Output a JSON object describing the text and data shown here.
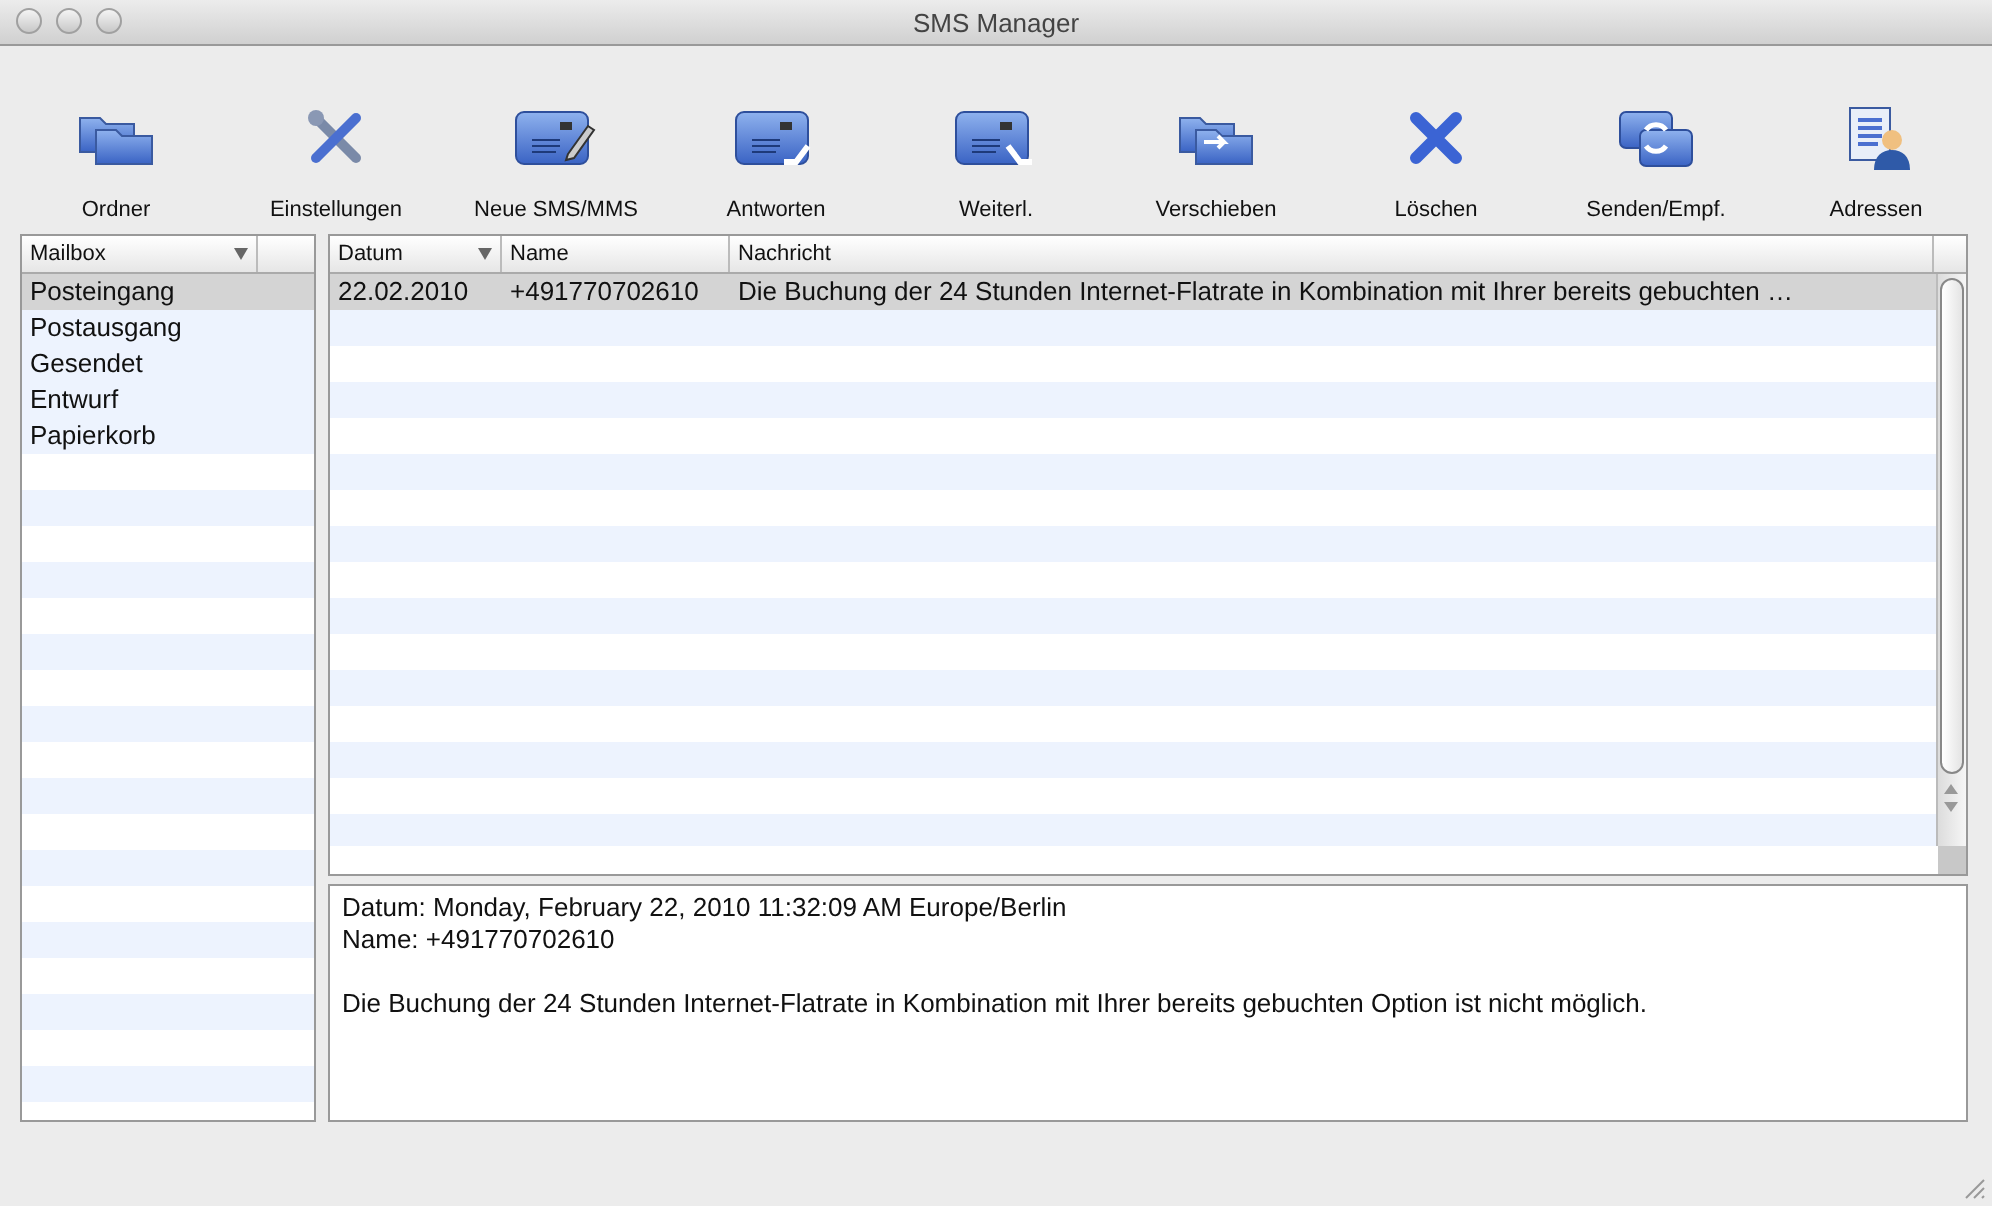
{
  "window": {
    "title": "SMS Manager"
  },
  "toolbar": [
    {
      "label": "Ordner",
      "kind": "folders"
    },
    {
      "label": "Einstellungen",
      "kind": "tools"
    },
    {
      "label": "Neue SMS/MMS",
      "kind": "compose"
    },
    {
      "label": "Antworten",
      "kind": "reply"
    },
    {
      "label": "Weiterl.",
      "kind": "forward"
    },
    {
      "label": "Verschieben",
      "kind": "move"
    },
    {
      "label": "Löschen",
      "kind": "delete"
    },
    {
      "label": "Senden/Empf.",
      "kind": "sync"
    },
    {
      "label": "Adressen",
      "kind": "contacts"
    }
  ],
  "mailboxes": {
    "column": "Mailbox",
    "items": [
      {
        "label": "Posteingang",
        "selected": true
      },
      {
        "label": "Postausgang",
        "selected": false
      },
      {
        "label": "Gesendet",
        "selected": false
      },
      {
        "label": "Entwurf",
        "selected": false
      },
      {
        "label": "Papierkorb",
        "selected": false
      }
    ]
  },
  "messages": {
    "columns": [
      "Datum",
      "Name",
      "Nachricht"
    ],
    "rows": [
      {
        "date": "22.02.2010",
        "name": "+491770702610",
        "text": "Die Buchung der 24 Stunden Internet-Flatrate in Kombination mit Ihrer bereits gebuchten …",
        "selected": true
      }
    ]
  },
  "preview": {
    "lines": [
      "Datum: Monday, February 22, 2010 11:32:09 AM Europe/Berlin",
      "Name: +491770702610"
    ],
    "body": "Die Buchung der 24 Stunden Internet-Flatrate in Kombination mit Ihrer bereits gebuchten Option ist nicht möglich."
  }
}
